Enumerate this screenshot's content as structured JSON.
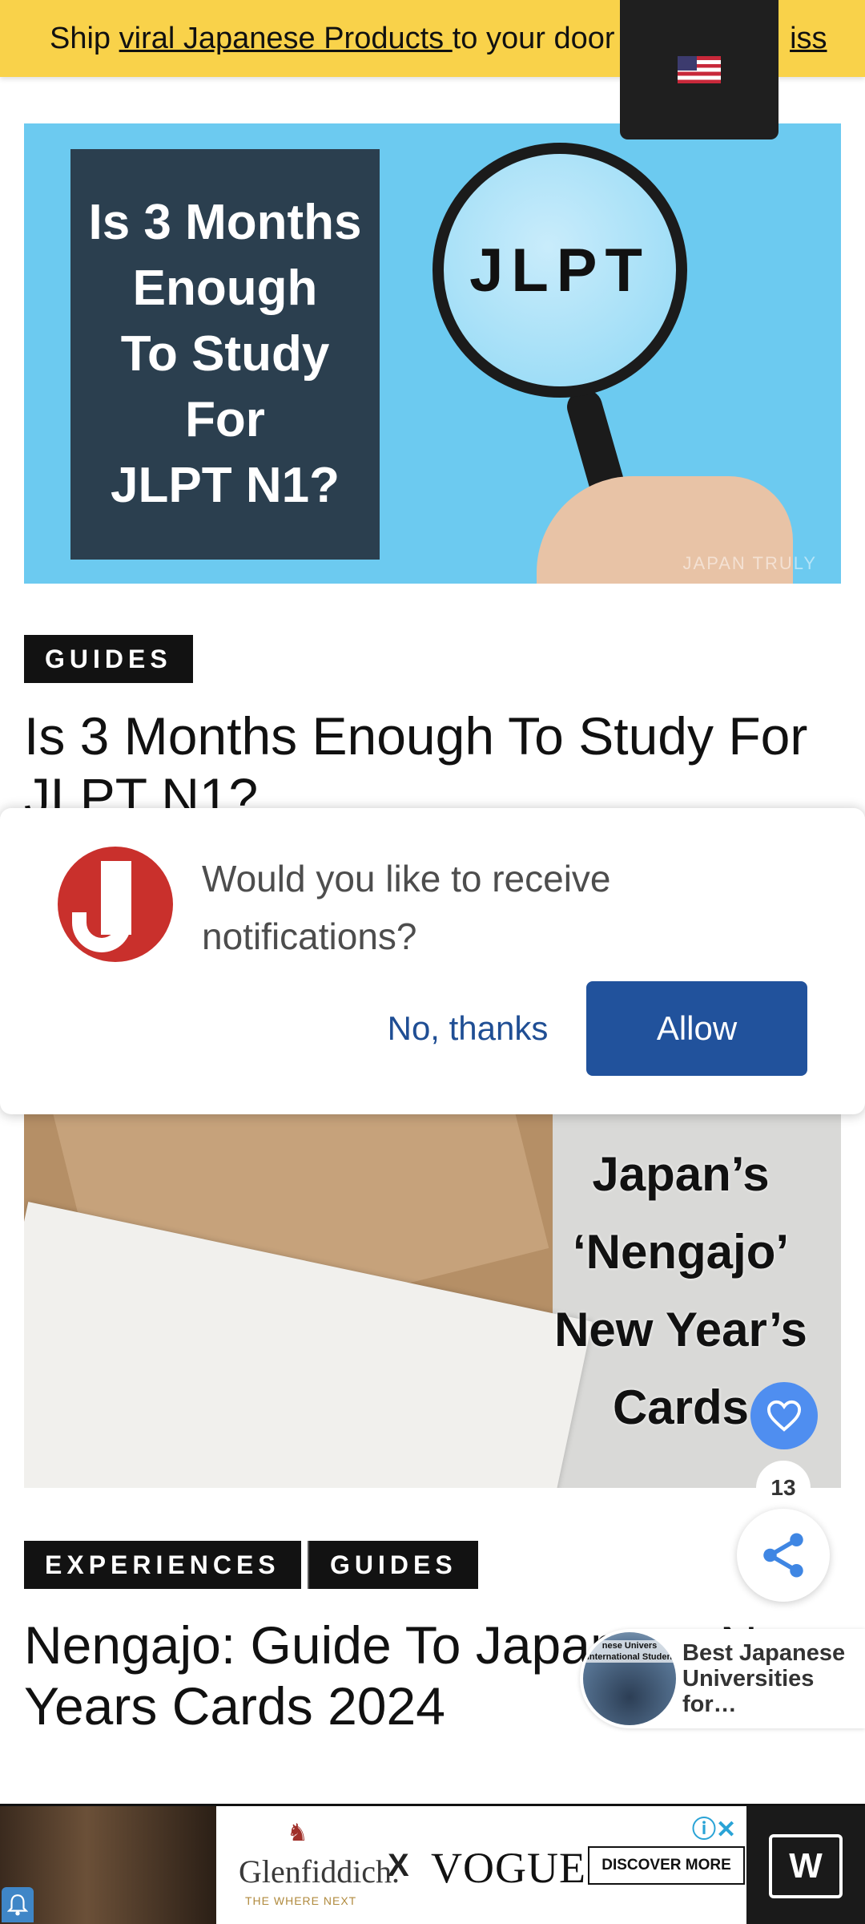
{
  "banner": {
    "text_before": "Ship ",
    "link_text": "viral Japanese Products ",
    "text_middle": "to your door ",
    "trailing_link": "iss"
  },
  "language": {
    "flag_icon": "us-flag-icon"
  },
  "article1": {
    "image_text": "Is 3 Months Enough To Study For JLPT N1?",
    "image_lines": [
      "Is 3 Months",
      "Enough",
      "To Study",
      "For",
      "JLPT N1?"
    ],
    "lens_text": "JLPT",
    "watermark": "JAPAN TRULY",
    "category": "GUIDES",
    "title": "Is 3 Months Enough To Study For JLPT N1?"
  },
  "notification": {
    "message": "Would you like to receive notifications?",
    "decline_label": "No, thanks",
    "allow_label": "Allow",
    "logo_icon": "site-logo-icon"
  },
  "article2": {
    "image_lines": [
      "Japan’s",
      "‘Nengajo’",
      "New Year’s",
      "Cards"
    ],
    "categories": [
      "EXPERIENCES",
      "GUIDES"
    ],
    "title": "Nengajo: Guide To Japanese New Years Cards 2024"
  },
  "floating": {
    "like_icon": "heart-icon",
    "like_count": "13",
    "share_icon": "share-icon"
  },
  "recommended": {
    "thumb_caption": "nese Univers International Studen",
    "title": "Best Japanese Universities for…"
  },
  "ad": {
    "brand1": "Glenfiddich.",
    "brand1_sub": "THE WHERE NEXT",
    "x": "X",
    "brand2": "VOGUE",
    "cta": "DISCOVER MORE",
    "adchoices": "ⓘ✕"
  },
  "colors": {
    "banner": "#f9d24a",
    "allow_button": "#21529c",
    "heart": "#4f8ef0",
    "brand_red": "#c9302c"
  }
}
